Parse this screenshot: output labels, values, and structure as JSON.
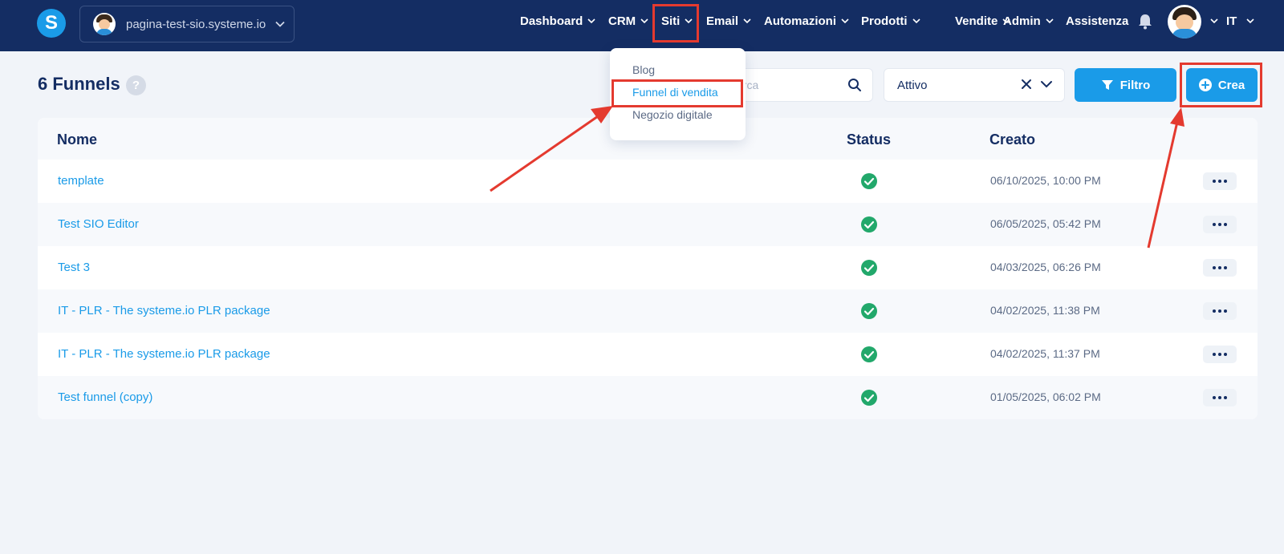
{
  "workspace": {
    "label": "pagina-test-sio.systeme.io"
  },
  "nav": {
    "items": [
      {
        "label": "Dashboard",
        "id": "dashboard"
      },
      {
        "label": "CRM",
        "id": "crm"
      },
      {
        "label": "Siti",
        "id": "siti"
      },
      {
        "label": "Email",
        "id": "email"
      },
      {
        "label": "Automazioni",
        "id": "automazioni"
      },
      {
        "label": "Prodotti",
        "id": "prodotti"
      },
      {
        "label": "Vendite",
        "id": "vendite"
      },
      {
        "label": "Admin",
        "id": "admin"
      }
    ],
    "help_label": "Assistenza",
    "language": "IT"
  },
  "dropdown": {
    "items": [
      "Blog",
      "Funnel di vendita",
      "Negozio digitale"
    ],
    "active": "Funnel di vendita"
  },
  "page": {
    "title": "6 Funnels",
    "help_glyph": "?",
    "search_placeholder": "erca",
    "status_value": "Attivo",
    "filter_label": "Filtro",
    "create_label": "Crea"
  },
  "table": {
    "headers": {
      "name": "Nome",
      "status": "Status",
      "created": "Creato"
    },
    "rows": [
      {
        "name": "template",
        "status": "active",
        "created": "06/10/2025, 10:00 PM"
      },
      {
        "name": "Test SIO Editor",
        "status": "active",
        "created": "06/05/2025, 05:42 PM"
      },
      {
        "name": "Test 3",
        "status": "active",
        "created": "04/03/2025, 06:26 PM"
      },
      {
        "name": "IT - PLR - The systeme.io PLR package",
        "status": "active",
        "created": "04/02/2025, 11:38 PM"
      },
      {
        "name": "IT - PLR - The systeme.io PLR package",
        "status": "active",
        "created": "04/02/2025, 11:37 PM"
      },
      {
        "name": "Test funnel (copy)",
        "status": "active",
        "created": "01/05/2025, 06:02 PM"
      }
    ]
  },
  "colors": {
    "navy": "#142d63",
    "accent": "#1a9be8",
    "success": "#22a86b",
    "annotation": "#e43a2f"
  },
  "icons": [
    "logo-icon",
    "chevron-down-icon",
    "bell-icon",
    "search-icon",
    "close-icon",
    "filter-icon",
    "plus-circle-icon",
    "check-circle-icon",
    "more-icon"
  ]
}
